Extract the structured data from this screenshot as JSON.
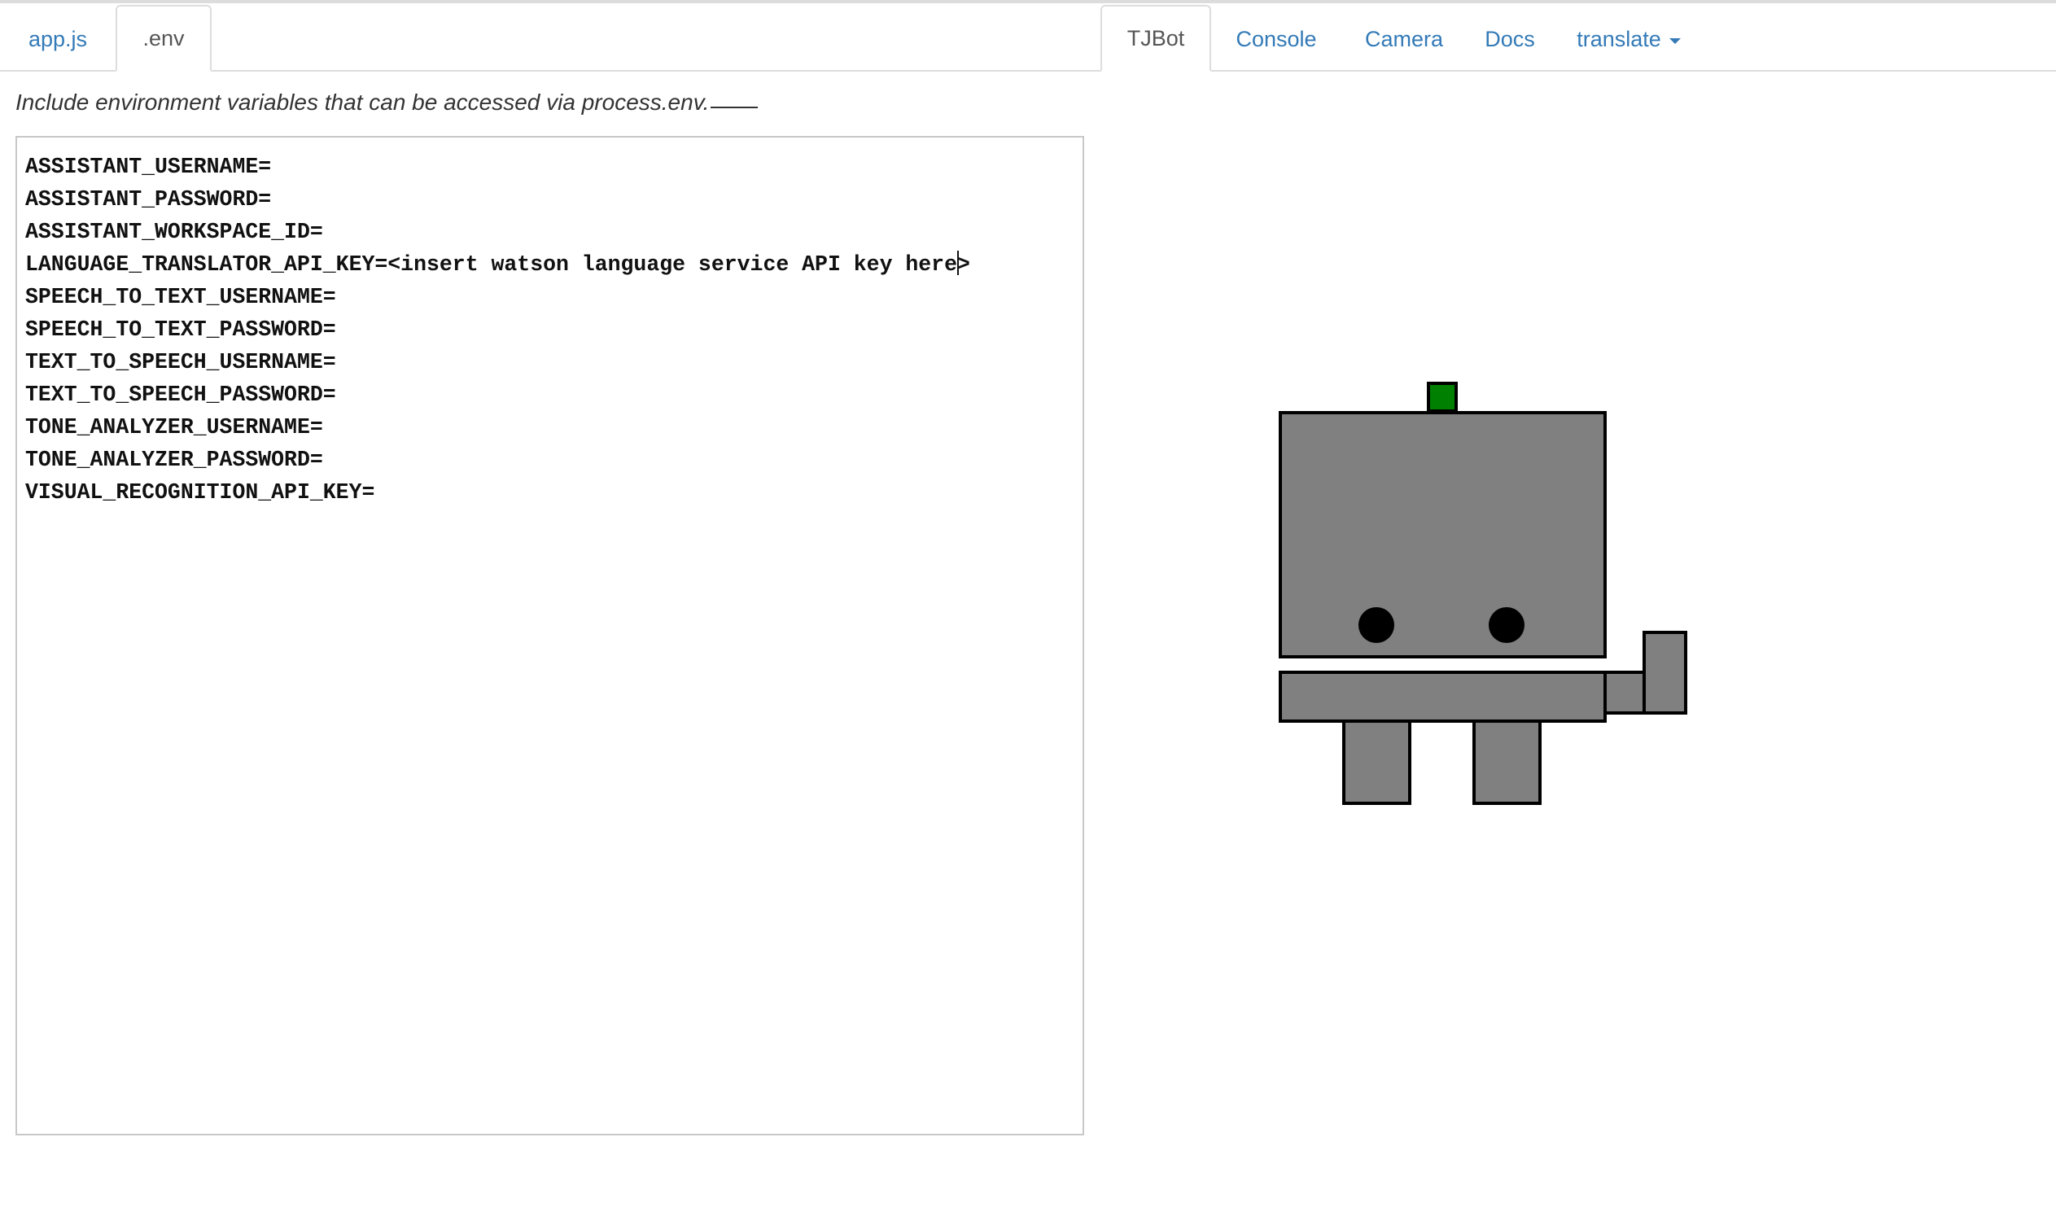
{
  "left_tabs": [
    {
      "label": "app.js",
      "active": false
    },
    {
      "label": ".env",
      "active": true
    }
  ],
  "right_tabs": {
    "tjbot": {
      "label": "TJBot",
      "active": true
    },
    "console": {
      "label": "Console"
    },
    "camera": {
      "label": "Camera"
    },
    "docs": {
      "label": "Docs"
    },
    "translate": {
      "label": "translate"
    }
  },
  "help": {
    "text": "Include environment variables that can be accessed via process.env."
  },
  "editor": {
    "lines": [
      "ASSISTANT_USERNAME=",
      "ASSISTANT_PASSWORD=",
      "ASSISTANT_WORKSPACE_ID=",
      "LANGUAGE_TRANSLATOR_API_KEY=<insert watson language service API key here",
      "SPEECH_TO_TEXT_USERNAME=",
      "SPEECH_TO_TEXT_PASSWORD=",
      "TEXT_TO_SPEECH_USERNAME=",
      "TEXT_TO_SPEECH_PASSWORD=",
      "TONE_ANALYZER_USERNAME=",
      "TONE_ANALYZER_PASSWORD=",
      "VISUAL_RECOGNITION_API_KEY="
    ],
    "cursor_line_tail": ">"
  },
  "colors": {
    "link": "#337ab7",
    "robot_body": "#808080",
    "robot_outline": "#000000",
    "robot_led": "#008000"
  }
}
